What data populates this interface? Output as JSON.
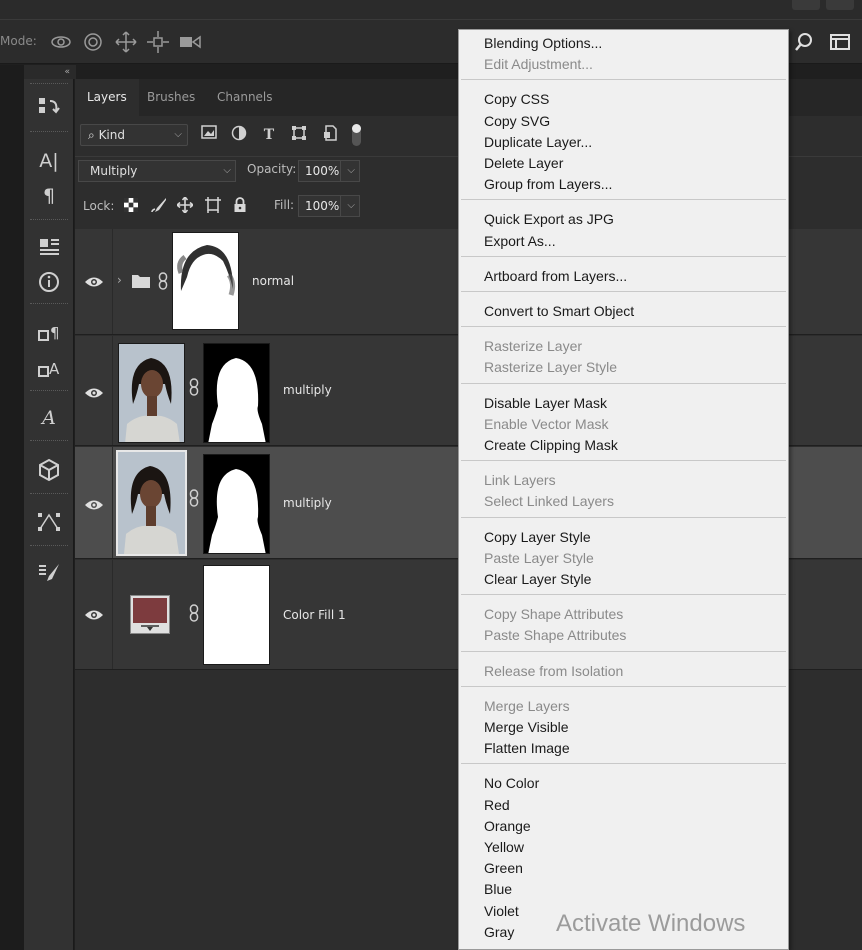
{
  "options_bar": {
    "mode_label": "Mode:"
  },
  "panel": {
    "tabs": [
      {
        "label": "Layers",
        "active": true
      },
      {
        "label": "Brushes",
        "active": false
      },
      {
        "label": "Channels",
        "active": false
      }
    ],
    "filter": {
      "kind_label": "Kind"
    },
    "blend_mode": "Multiply",
    "opacity_label": "Opacity:",
    "opacity_value": "100%",
    "lock_label": "Lock:",
    "fill_label": "Fill:",
    "fill_value": "100%"
  },
  "layers": [
    {
      "name": "normal",
      "type": "group",
      "visible": true,
      "selected": false
    },
    {
      "name": "multiply",
      "type": "image-with-mask",
      "visible": true,
      "selected": false
    },
    {
      "name": "multiply",
      "type": "image-with-mask",
      "visible": true,
      "selected": true
    },
    {
      "name": "Color Fill 1",
      "type": "fill",
      "visible": true,
      "selected": false,
      "swatch_color": "#7d3b3e"
    }
  ],
  "context_menu": {
    "groups": [
      [
        {
          "label": "Blending Options...",
          "enabled": true
        },
        {
          "label": "Edit Adjustment...",
          "enabled": false
        }
      ],
      [
        {
          "label": "Copy CSS",
          "enabled": true
        },
        {
          "label": "Copy SVG",
          "enabled": true
        },
        {
          "label": "Duplicate Layer...",
          "enabled": true
        },
        {
          "label": "Delete Layer",
          "enabled": true
        },
        {
          "label": "Group from Layers...",
          "enabled": true
        }
      ],
      [
        {
          "label": "Quick Export as JPG",
          "enabled": true
        },
        {
          "label": "Export As...",
          "enabled": true
        }
      ],
      [
        {
          "label": "Artboard from Layers...",
          "enabled": true
        }
      ],
      [
        {
          "label": "Convert to Smart Object",
          "enabled": true
        }
      ],
      [
        {
          "label": "Rasterize Layer",
          "enabled": false
        },
        {
          "label": "Rasterize Layer Style",
          "enabled": false
        }
      ],
      [
        {
          "label": "Disable Layer Mask",
          "enabled": true
        },
        {
          "label": "Enable Vector Mask",
          "enabled": false
        },
        {
          "label": "Create Clipping Mask",
          "enabled": true
        }
      ],
      [
        {
          "label": "Link Layers",
          "enabled": false
        },
        {
          "label": "Select Linked Layers",
          "enabled": false
        }
      ],
      [
        {
          "label": "Copy Layer Style",
          "enabled": true
        },
        {
          "label": "Paste Layer Style",
          "enabled": false
        },
        {
          "label": "Clear Layer Style",
          "enabled": true
        }
      ],
      [
        {
          "label": "Copy Shape Attributes",
          "enabled": false
        },
        {
          "label": "Paste Shape Attributes",
          "enabled": false
        }
      ],
      [
        {
          "label": "Release from Isolation",
          "enabled": false
        }
      ],
      [
        {
          "label": "Merge Layers",
          "enabled": false
        },
        {
          "label": "Merge Visible",
          "enabled": true
        },
        {
          "label": "Flatten Image",
          "enabled": true
        }
      ],
      [
        {
          "label": "No Color",
          "enabled": true
        },
        {
          "label": "Red",
          "enabled": true
        },
        {
          "label": "Orange",
          "enabled": true
        },
        {
          "label": "Yellow",
          "enabled": true
        },
        {
          "label": "Green",
          "enabled": true
        },
        {
          "label": "Blue",
          "enabled": true
        },
        {
          "label": "Violet",
          "enabled": true
        },
        {
          "label": "Gray",
          "enabled": true
        }
      ]
    ]
  },
  "watermark": {
    "line1": "Activate Windows"
  }
}
